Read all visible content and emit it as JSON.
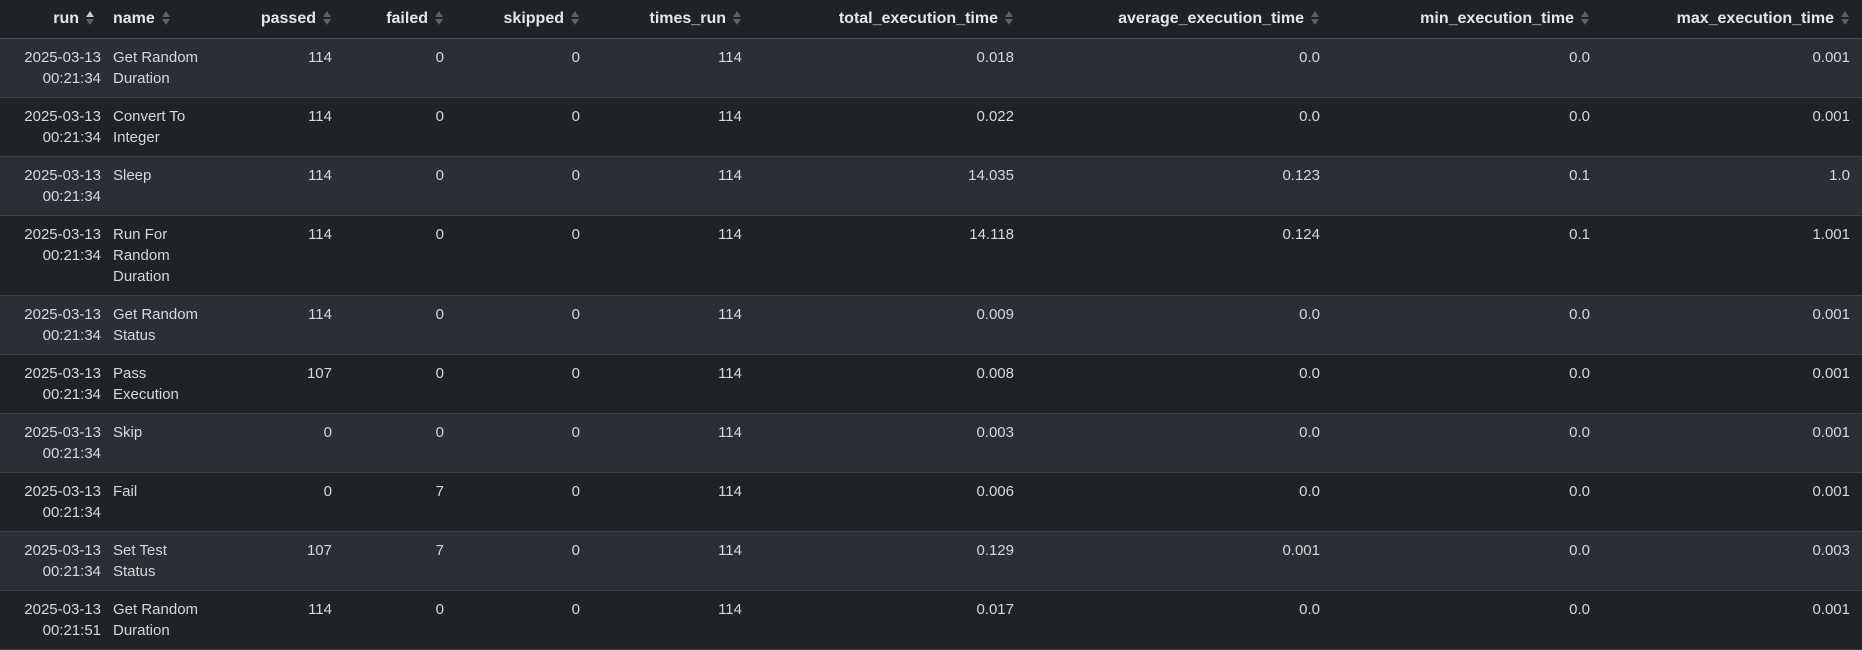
{
  "table": {
    "columns": [
      {
        "key": "run",
        "label": "run",
        "sort": "asc"
      },
      {
        "key": "name",
        "label": "name",
        "sort": "none"
      },
      {
        "key": "passed",
        "label": "passed",
        "sort": "none"
      },
      {
        "key": "failed",
        "label": "failed",
        "sort": "none"
      },
      {
        "key": "skipped",
        "label": "skipped",
        "sort": "none"
      },
      {
        "key": "times_run",
        "label": "times_run",
        "sort": "none"
      },
      {
        "key": "total_execution_time",
        "label": "total_execution_time",
        "sort": "none"
      },
      {
        "key": "average_execution_time",
        "label": "average_execution_time",
        "sort": "none"
      },
      {
        "key": "min_execution_time",
        "label": "min_execution_time",
        "sort": "none"
      },
      {
        "key": "max_execution_time",
        "label": "max_execution_time",
        "sort": "none"
      }
    ],
    "rows": [
      {
        "run_date": "2025-03-13",
        "run_time": "00:21:34",
        "name": "Get Random Duration",
        "passed": "114",
        "failed": "0",
        "skipped": "0",
        "times_run": "114",
        "total_execution_time": "0.018",
        "average_execution_time": "0.0",
        "min_execution_time": "0.0",
        "max_execution_time": "0.001"
      },
      {
        "run_date": "2025-03-13",
        "run_time": "00:21:34",
        "name": "Convert To Integer",
        "passed": "114",
        "failed": "0",
        "skipped": "0",
        "times_run": "114",
        "total_execution_time": "0.022",
        "average_execution_time": "0.0",
        "min_execution_time": "0.0",
        "max_execution_time": "0.001"
      },
      {
        "run_date": "2025-03-13",
        "run_time": "00:21:34",
        "name": "Sleep",
        "passed": "114",
        "failed": "0",
        "skipped": "0",
        "times_run": "114",
        "total_execution_time": "14.035",
        "average_execution_time": "0.123",
        "min_execution_time": "0.1",
        "max_execution_time": "1.0"
      },
      {
        "run_date": "2025-03-13",
        "run_time": "00:21:34",
        "name": "Run For Random Duration",
        "passed": "114",
        "failed": "0",
        "skipped": "0",
        "times_run": "114",
        "total_execution_time": "14.118",
        "average_execution_time": "0.124",
        "min_execution_time": "0.1",
        "max_execution_time": "1.001"
      },
      {
        "run_date": "2025-03-13",
        "run_time": "00:21:34",
        "name": "Get Random Status",
        "passed": "114",
        "failed": "0",
        "skipped": "0",
        "times_run": "114",
        "total_execution_time": "0.009",
        "average_execution_time": "0.0",
        "min_execution_time": "0.0",
        "max_execution_time": "0.001"
      },
      {
        "run_date": "2025-03-13",
        "run_time": "00:21:34",
        "name": "Pass Execution",
        "passed": "107",
        "failed": "0",
        "skipped": "0",
        "times_run": "114",
        "total_execution_time": "0.008",
        "average_execution_time": "0.0",
        "min_execution_time": "0.0",
        "max_execution_time": "0.001"
      },
      {
        "run_date": "2025-03-13",
        "run_time": "00:21:34",
        "name": "Skip",
        "passed": "0",
        "failed": "0",
        "skipped": "0",
        "times_run": "114",
        "total_execution_time": "0.003",
        "average_execution_time": "0.0",
        "min_execution_time": "0.0",
        "max_execution_time": "0.001"
      },
      {
        "run_date": "2025-03-13",
        "run_time": "00:21:34",
        "name": "Fail",
        "passed": "0",
        "failed": "7",
        "skipped": "0",
        "times_run": "114",
        "total_execution_time": "0.006",
        "average_execution_time": "0.0",
        "min_execution_time": "0.0",
        "max_execution_time": "0.001"
      },
      {
        "run_date": "2025-03-13",
        "run_time": "00:21:34",
        "name": "Set Test Status",
        "passed": "107",
        "failed": "7",
        "skipped": "0",
        "times_run": "114",
        "total_execution_time": "0.129",
        "average_execution_time": "0.001",
        "min_execution_time": "0.0",
        "max_execution_time": "0.003"
      },
      {
        "run_date": "2025-03-13",
        "run_time": "00:21:51",
        "name": "Get Random Duration",
        "passed": "114",
        "failed": "0",
        "skipped": "0",
        "times_run": "114",
        "total_execution_time": "0.017",
        "average_execution_time": "0.0",
        "min_execution_time": "0.0",
        "max_execution_time": "0.001"
      }
    ]
  },
  "icons": {
    "sort_asc": "sort-ascending-icon",
    "sort_none": "sort-neutral-icon"
  },
  "colors": {
    "background": "#1f2227",
    "row_stripe": "#2b2e34",
    "text": "#d6d8db",
    "sort_active": "#c9ccd1",
    "sort_inactive": "#5d6168"
  }
}
